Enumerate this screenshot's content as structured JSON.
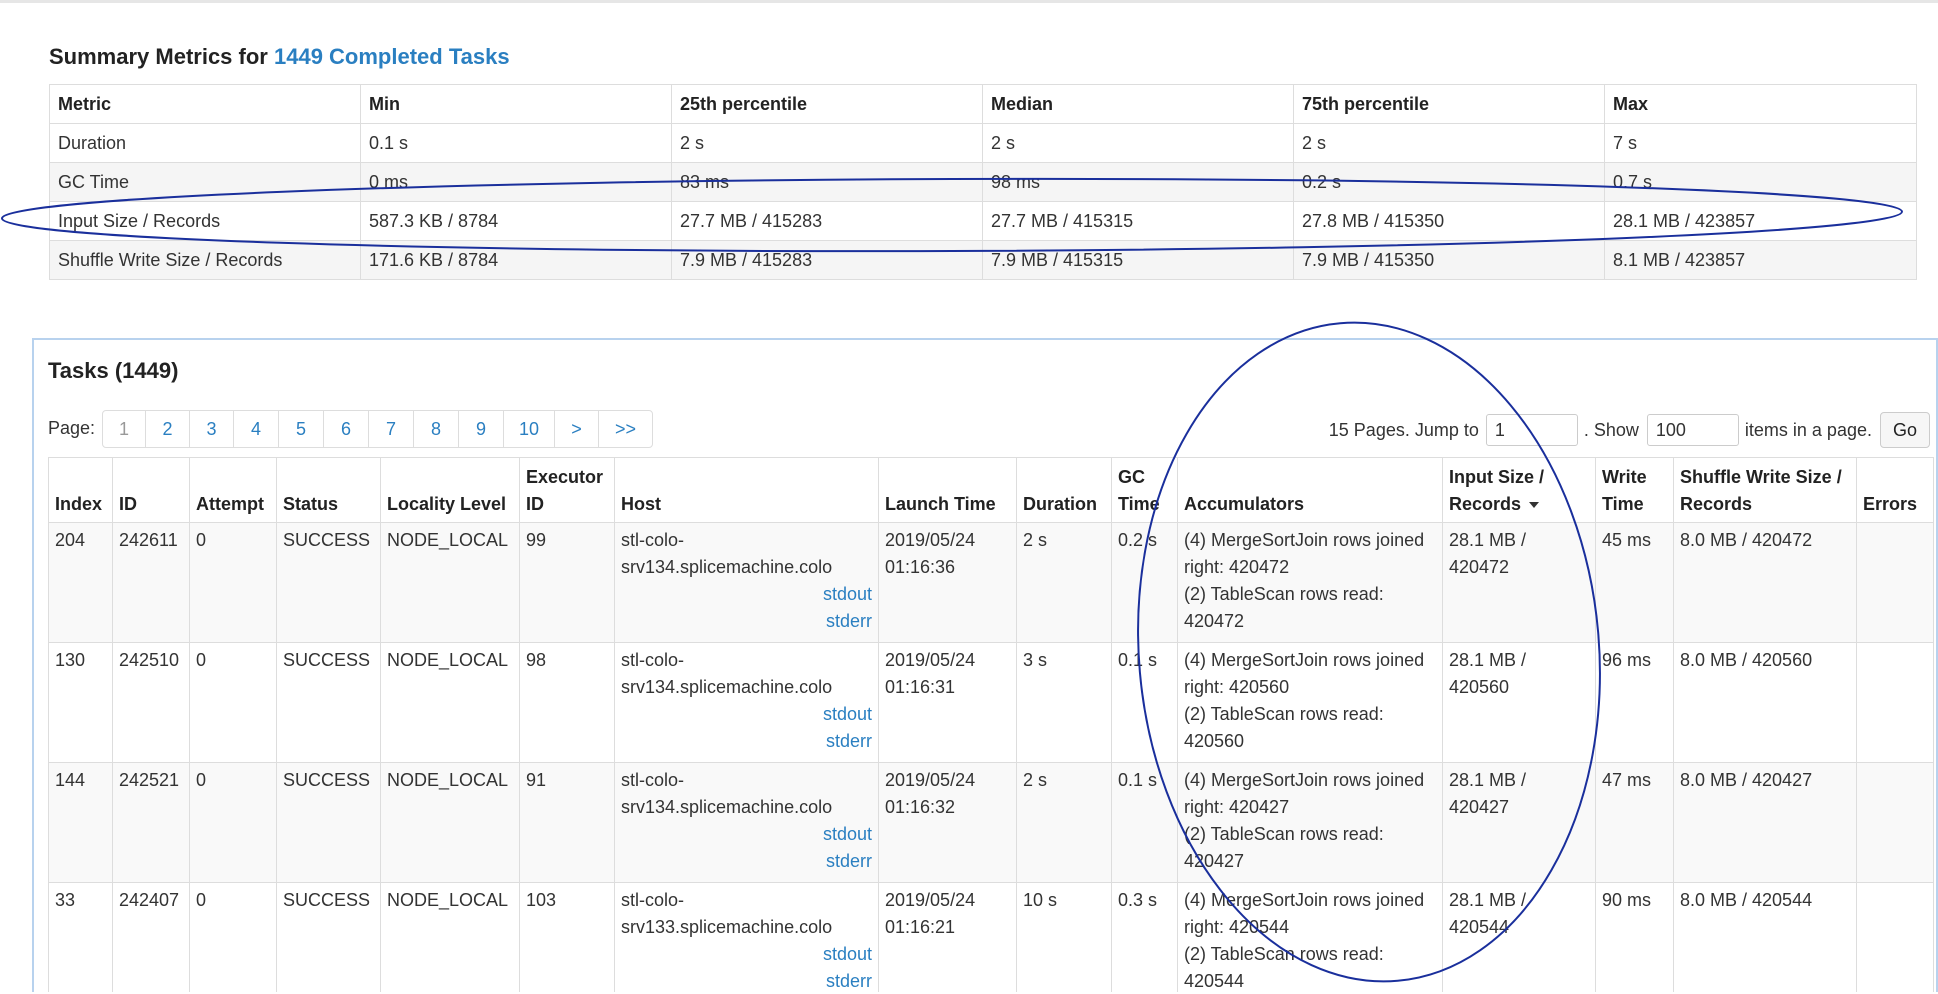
{
  "summary": {
    "title_prefix": "Summary Metrics for",
    "title_link": "1449 Completed Tasks",
    "columns": [
      "Metric",
      "Min",
      "25th percentile",
      "Median",
      "75th percentile",
      "Max"
    ],
    "rows": [
      [
        "Duration",
        "0.1 s",
        "2 s",
        "2 s",
        "2 s",
        "7 s"
      ],
      [
        "GC Time",
        "0 ms",
        "83 ms",
        "98 ms",
        "0.2 s",
        "0.7 s"
      ],
      [
        "Input Size / Records",
        "587.3 KB / 8784",
        "27.7 MB / 415283",
        "27.7 MB / 415315",
        "27.8 MB / 415350",
        "28.1 MB / 423857"
      ],
      [
        "Shuffle Write Size / Records",
        "171.6 KB / 8784",
        "7.9 MB / 415283",
        "7.9 MB / 415315",
        "7.9 MB / 415350",
        "8.1 MB / 423857"
      ]
    ]
  },
  "tasks": {
    "title": "Tasks (1449)",
    "page_label": "Page:",
    "pages": [
      "1",
      "2",
      "3",
      "4",
      "5",
      "6",
      "7",
      "8",
      "9",
      "10",
      ">",
      ">>"
    ],
    "jump": {
      "pages_text": "15 Pages. Jump to",
      "page_value": "1",
      "show_text": ". Show",
      "show_value": "100",
      "items_text": "items in a page.",
      "go_label": "Go"
    },
    "columns": {
      "index": "Index",
      "id": "ID",
      "attempt": "Attempt",
      "status": "Status",
      "locality": "Locality Level",
      "executor_a": "Executor",
      "executor_b": "ID",
      "host": "Host",
      "launch": "Launch Time",
      "duration": "Duration",
      "gc_a": "GC",
      "gc_b": "Time",
      "accumulators": "Accumulators",
      "input_a": "Input Size /",
      "input_b": "Records",
      "write_a": "Write",
      "write_b": "Time",
      "shuffle_a": "Shuffle Write Size /",
      "shuffle_b": "Records",
      "errors": "Errors"
    },
    "rows": [
      {
        "index": "204",
        "id": "242611",
        "attempt": "0",
        "status": "SUCCESS",
        "locality": "NODE_LOCAL",
        "executor": "99",
        "host_a": "stl-colo-",
        "host_b": "srv134.splicemachine.colo",
        "stdout": "stdout",
        "stderr": "stderr",
        "launch_date": "2019/05/24",
        "launch_time": "01:16:36",
        "duration": "2 s",
        "gc": "0.2 s",
        "acc_1": "(4) MergeSortJoin rows joined",
        "acc_2": "right: 420472",
        "acc_3": "(2) TableScan rows read:",
        "acc_4": "420472",
        "input_a": "28.1 MB /",
        "input_b": "420472",
        "write_time": "45 ms",
        "shuffle": "8.0 MB / 420472",
        "errors": ""
      },
      {
        "index": "130",
        "id": "242510",
        "attempt": "0",
        "status": "SUCCESS",
        "locality": "NODE_LOCAL",
        "executor": "98",
        "host_a": "stl-colo-",
        "host_b": "srv134.splicemachine.colo",
        "stdout": "stdout",
        "stderr": "stderr",
        "launch_date": "2019/05/24",
        "launch_time": "01:16:31",
        "duration": "3 s",
        "gc": "0.1 s",
        "acc_1": "(4) MergeSortJoin rows joined",
        "acc_2": "right: 420560",
        "acc_3": "(2) TableScan rows read:",
        "acc_4": "420560",
        "input_a": "28.1 MB /",
        "input_b": "420560",
        "write_time": "96 ms",
        "shuffle": "8.0 MB / 420560",
        "errors": ""
      },
      {
        "index": "144",
        "id": "242521",
        "attempt": "0",
        "status": "SUCCESS",
        "locality": "NODE_LOCAL",
        "executor": "91",
        "host_a": "stl-colo-",
        "host_b": "srv134.splicemachine.colo",
        "stdout": "stdout",
        "stderr": "stderr",
        "launch_date": "2019/05/24",
        "launch_time": "01:16:32",
        "duration": "2 s",
        "gc": "0.1 s",
        "acc_1": "(4) MergeSortJoin rows joined",
        "acc_2": "right: 420427",
        "acc_3": "(2) TableScan rows read:",
        "acc_4": "420427",
        "input_a": "28.1 MB /",
        "input_b": "420427",
        "write_time": "47 ms",
        "shuffle": "8.0 MB / 420427",
        "errors": ""
      },
      {
        "index": "33",
        "id": "242407",
        "attempt": "0",
        "status": "SUCCESS",
        "locality": "NODE_LOCAL",
        "executor": "103",
        "host_a": "stl-colo-",
        "host_b": "srv133.splicemachine.colo",
        "stdout": "stdout",
        "stderr": "stderr",
        "launch_date": "2019/05/24",
        "launch_time": "01:16:21",
        "duration": "10 s",
        "gc": "0.3 s",
        "acc_1": "(4) MergeSortJoin rows joined",
        "acc_2": "right: 420544",
        "acc_3": "(2) TableScan rows read:",
        "acc_4": "420544",
        "input_a": "28.1 MB /",
        "input_b": "420544",
        "write_time": "90 ms",
        "shuffle": "8.0 MB / 420544",
        "errors": ""
      }
    ]
  },
  "annotations": {
    "color": "#1a2f9c",
    "shapes": [
      "ellipse-around-input-size-row",
      "ellipse-around-accumulators-and-input-columns"
    ]
  }
}
